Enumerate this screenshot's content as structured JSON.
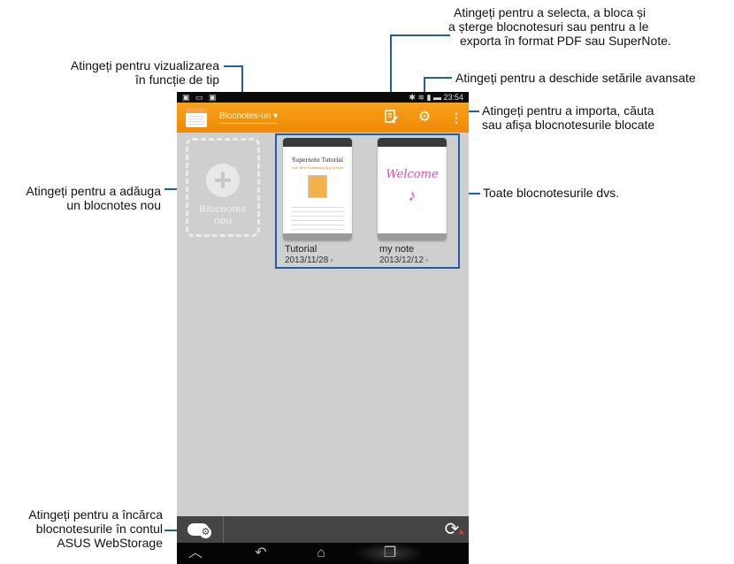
{
  "callouts": {
    "view_by_type": [
      "Atingeți pentru vizualizarea",
      "în funcție de tip"
    ],
    "select_lock": [
      "Atingeți pentru a selecta, a bloca și",
      "a șterge blocnotesuri sau pentru a le",
      "exporta în format PDF sau SuperNote."
    ],
    "settings": [
      "Atingeți pentru a deschide setările avansate"
    ],
    "import_search": [
      "Atingeți pentru a importa, căuta",
      "sau afișa blocnotesurile blocate"
    ],
    "add_notebook": [
      "Atingeți pentru a adăuga",
      "un blocnotes nou"
    ],
    "all_notebooks": [
      "Toate blocnotesurile dvs."
    ],
    "upload": [
      "Atingeți pentru a încărca",
      "blocnotesurile în contul",
      "ASUS WebStorage"
    ]
  },
  "statusbar": {
    "time": "23:54"
  },
  "actionbar": {
    "dropdown_label": "Blocnotes-uri"
  },
  "new_notebook": {
    "label_line1": "Blocnotes",
    "label_line2": "nou"
  },
  "notebooks": [
    {
      "name": "Tutorial",
      "date": "2013/11/28",
      "cover_title": "Supernote Tutorial",
      "cover_subtitle": "Your Best Notetaking App is Here"
    },
    {
      "name": "my note",
      "date": "2013/12/12",
      "cover_text": "Welcome"
    }
  ],
  "icons": {
    "edit": "edit-icon",
    "settings": "gear-icon",
    "menu": "overflow-menu-icon",
    "upload": "cloud-upload-icon",
    "sync": "sync-icon",
    "back": "back-icon",
    "home": "home-icon",
    "recent": "recent-apps-icon"
  },
  "colors": {
    "actionbar": "#f39514",
    "callout_line": "#1e5fa8",
    "content_bg": "#cfcfcf"
  }
}
